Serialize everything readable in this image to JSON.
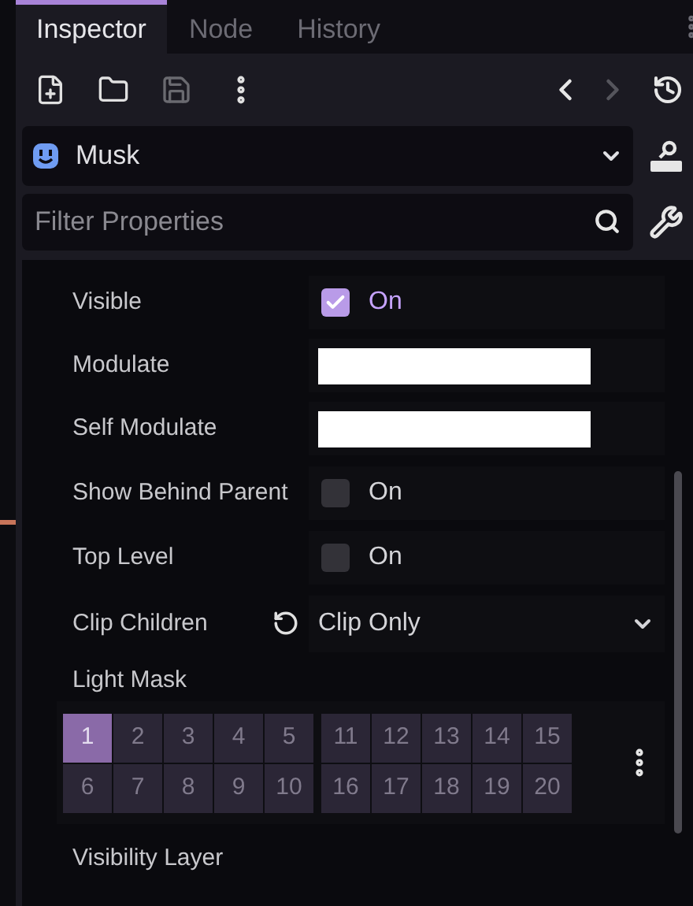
{
  "tabs": [
    {
      "label": "Inspector",
      "selected": true
    },
    {
      "label": "Node",
      "selected": false
    },
    {
      "label": "History",
      "selected": false
    }
  ],
  "toolbar": {
    "save_disabled": true,
    "back_disabled": false,
    "forward_disabled": true
  },
  "object": {
    "name": "Musk"
  },
  "filter": {
    "placeholder": "Filter Properties"
  },
  "properties": [
    {
      "kind": "check",
      "label": "Visible",
      "checked": true,
      "value": "On"
    },
    {
      "kind": "color",
      "label": "Modulate"
    },
    {
      "kind": "color",
      "label": "Self Modulate"
    },
    {
      "kind": "check",
      "label": "Show Behind Parent",
      "checked": false,
      "value": "On"
    },
    {
      "kind": "check",
      "label": "Top Level",
      "checked": false,
      "value": "On"
    },
    {
      "kind": "enum",
      "label": "Clip Children",
      "value": "Clip Only",
      "revertable": true
    },
    {
      "kind": "layers",
      "label": "Light Mask",
      "cells": [
        {
          "label": "1",
          "selected": true
        },
        {
          "label": "2",
          "selected": false
        },
        {
          "label": "3",
          "selected": false
        },
        {
          "label": "4",
          "selected": false
        },
        {
          "label": "5",
          "selected": false
        },
        {
          "label": "11",
          "selected": false
        },
        {
          "label": "12",
          "selected": false
        },
        {
          "label": "13",
          "selected": false
        },
        {
          "label": "14",
          "selected": false
        },
        {
          "label": "15",
          "selected": false
        },
        {
          "label": "6",
          "selected": false
        },
        {
          "label": "7",
          "selected": false
        },
        {
          "label": "8",
          "selected": false
        },
        {
          "label": "9",
          "selected": false
        },
        {
          "label": "10",
          "selected": false
        },
        {
          "label": "16",
          "selected": false
        },
        {
          "label": "17",
          "selected": false
        },
        {
          "label": "18",
          "selected": false
        },
        {
          "label": "19",
          "selected": false
        },
        {
          "label": "20",
          "selected": false
        }
      ]
    },
    {
      "kind": "label",
      "label": "Visibility Layer"
    }
  ]
}
